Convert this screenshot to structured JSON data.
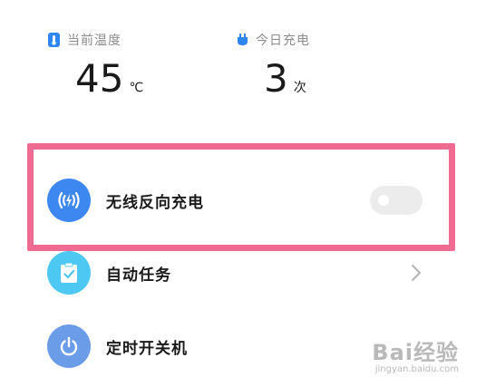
{
  "stats": {
    "temperature": {
      "label": "当前温度",
      "value": "45",
      "unit": "℃",
      "icon": "thermometer-icon",
      "color": "#2e86f0"
    },
    "charges": {
      "label": "今日充电",
      "value": "3",
      "unit": "次",
      "icon": "plug-icon",
      "color": "#2e86f0"
    }
  },
  "settings": [
    {
      "label": "无线反向充电",
      "icon": "wireless-charging-icon",
      "icon_color": "#3d88f0",
      "control": "toggle",
      "enabled": false
    },
    {
      "label": "自动任务",
      "icon": "clipboard-check-icon",
      "icon_color": "#4cc8f2",
      "control": "chevron"
    },
    {
      "label": "定时开关机",
      "icon": "power-icon",
      "icon_color": "#6b9ce8",
      "control": "none"
    }
  ],
  "highlight_color": "#f06b91",
  "watermark": {
    "main": "Bai经验",
    "sub": "jingyan.baidu.com"
  }
}
